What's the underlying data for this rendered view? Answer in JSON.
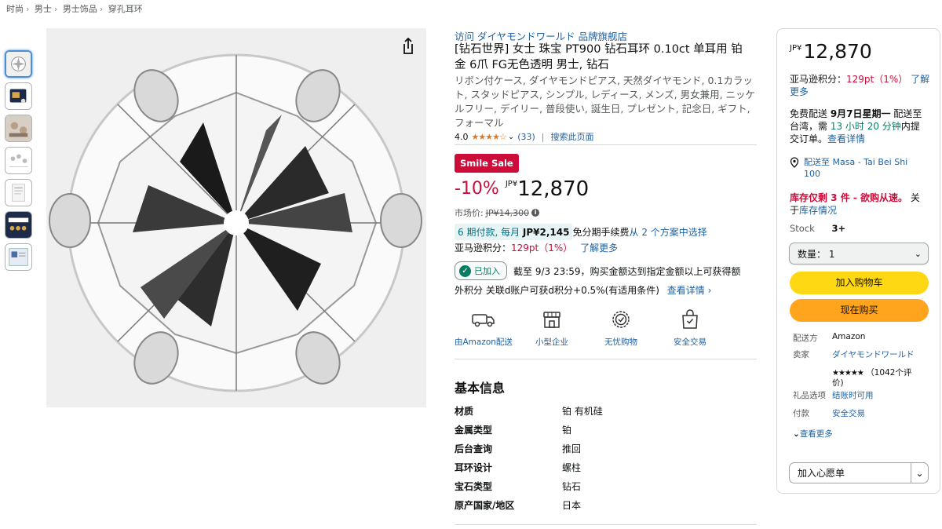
{
  "breadcrumb": [
    {
      "label": "时尚",
      "sep": "›"
    },
    {
      "label": "男士",
      "sep": "›"
    },
    {
      "label": "男士饰品",
      "sep": "›"
    },
    {
      "label": "穿孔耳环",
      "sep": ""
    }
  ],
  "product": {
    "store_link": "访问 ダイヤモンドワールド 品牌旗舰店",
    "title": "[钻石世界] 女士 珠宝 PT900 钻石耳环 0.10ct 单耳用 铂金 6爪 FG无色透明 男士, 钻石",
    "subtitle": "リボン付ケース, ダイヤモンドピアス, 天然ダイヤモンド, 0.1カラット, スタッドピアス, シンプル, レディース, メンズ, 男女兼用, ニッケルフリー, デイリー, 普段使い, 誕生日, プレゼント, 記念日, ギフト, フォーマル",
    "rating_value": "4.0",
    "stars": "★★★★☆",
    "rating_count": "(33)",
    "rating_sep": "|",
    "search_page": "搜索此页面"
  },
  "deal": {
    "badge": "Smile Sale",
    "discount": "-10%",
    "currency": "JP¥",
    "price": "12,870",
    "list_price_label": "市场价:",
    "list_price": "JP¥14,300",
    "installment_a": "6 期付款, 每月 ",
    "installment_amount": "JP¥2,145",
    "installment_b": " 免分期手续费 ",
    "installment_link": "从 2 个方案中选择",
    "points_label": "亚马逊积分：",
    "points_value": "129pt（1%）",
    "points_link": "了解更多",
    "coupon_btn": "已加入",
    "coupon_text": "截至 9/3 23:59，购买金额达到指定金额以上可获得额",
    "dpoint_text": "外积分 关联d账户可获d积分+0.5%(有适用条件)",
    "dpoint_link": "查看详情 ›"
  },
  "features": [
    {
      "icon": "delivery-truck-icon",
      "label": "由Amazon配送"
    },
    {
      "icon": "small-business-icon",
      "label": "小型企业"
    },
    {
      "icon": "worry-free-badge-icon",
      "label": "无忧购物"
    },
    {
      "icon": "secure-bag-icon",
      "label": "安全交易"
    }
  ],
  "basic_info": {
    "title": "基本信息",
    "rows": [
      {
        "k": "材质",
        "v": "铂 有机硅"
      },
      {
        "k": "金属类型",
        "v": "铂"
      },
      {
        "k": "后台查询",
        "v": "推回"
      },
      {
        "k": "耳环设计",
        "v": "螺柱"
      },
      {
        "k": "宝石类型",
        "v": "钻石"
      },
      {
        "k": "原产国家/地区",
        "v": "日本"
      }
    ]
  },
  "buybox": {
    "currency": "JP¥",
    "price": "12,870",
    "points_label": "亚马逊积分：",
    "points_value": "129pt（1%）",
    "points_link_a": "了解",
    "points_link_b": "更多",
    "delivery_line1_a": "免费配送 ",
    "delivery_date": "9月7日星期一",
    "delivery_line1_b": " 配送至",
    "delivery_line2_a": "台湾，需 ",
    "delivery_countdown": "13 小时 20 分钟",
    "delivery_line2_b": "内提",
    "delivery_line3": "交订单。",
    "delivery_link": "查看详情",
    "deliver_to_a": "配送至 Masa - Tai Bei Shi",
    "deliver_to_b": "100",
    "stock_warn": "库存仅剩 3 件 - 欲购从速。",
    "stock_about": " 关",
    "stock_link_a": "于",
    "stock_link_b": "库存情况",
    "stock_label": "Stock",
    "stock_value": "3+",
    "qty_label": "数量： 1",
    "add_to_cart": "加入购物车",
    "buy_now": "现在购买",
    "ships_from_k": "配送方",
    "ships_from_v": "Amazon",
    "sold_by_k": "卖家",
    "sold_by_v": "ダイヤモンドワールド",
    "seller_stars": "★★★★★",
    "seller_reviews_a": "（1042个评",
    "seller_reviews_b": "价)",
    "gift_k": "礼品选项",
    "gift_v": "结账时可用",
    "payment_k": "付款",
    "payment_v": "安全交易",
    "see_more": "查看更多",
    "wishlist": "加入心愿单"
  },
  "colors": {
    "deal_red": "#cc0c39",
    "link_blue": "#2162a1",
    "cart_yellow": "#ffd814",
    "buy_orange": "#ffa41c",
    "success_green": "#067d62"
  }
}
